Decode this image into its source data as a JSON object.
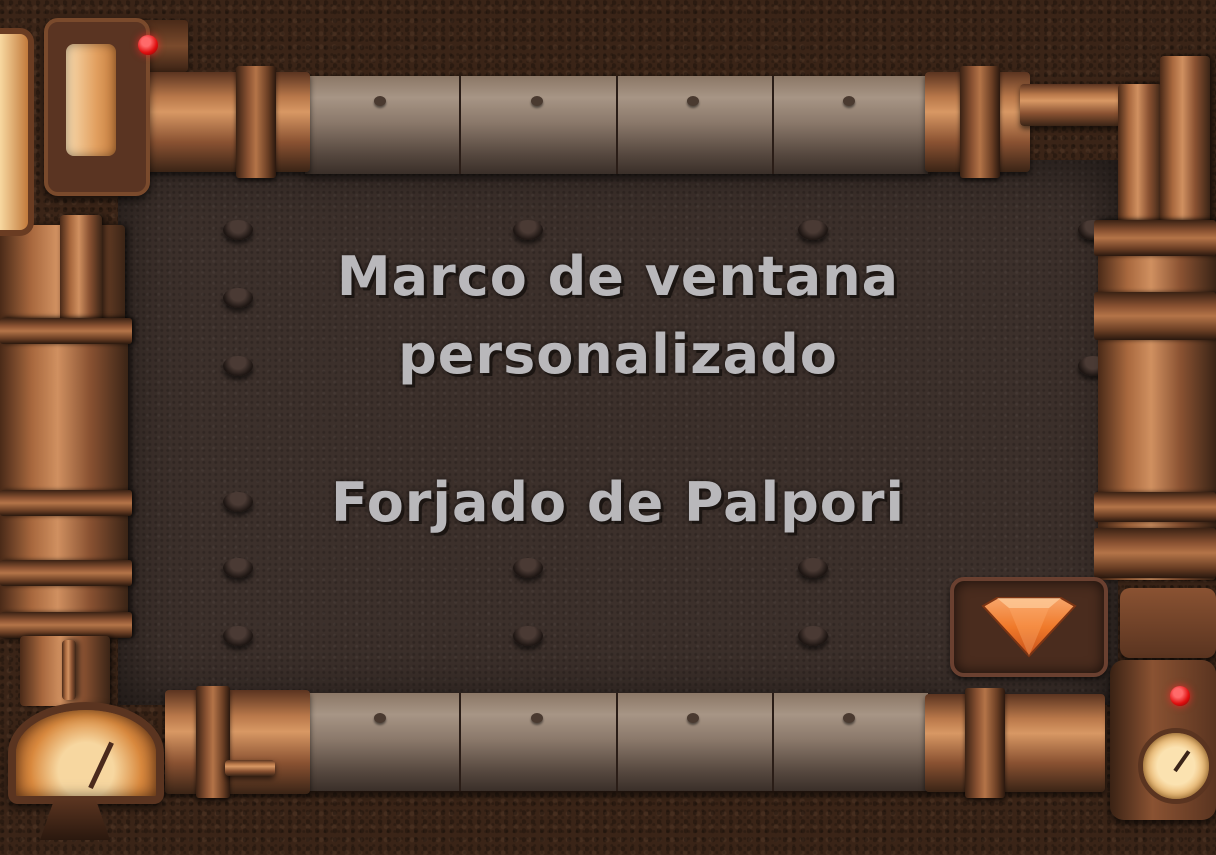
{
  "window": {
    "title_line1": "Marco de ventana",
    "title_line2": "personalizado",
    "subtitle": "Forjado de Palpori"
  },
  "controls": {
    "scroll_down_icon": "orange-gem-down-arrow-icon",
    "status_lamp_icon": "red-indicator-lamp-icon",
    "gauge_icon": "pressure-gauge-icon"
  },
  "colors": {
    "text": "#b9b8bb",
    "panel": "#3c302b",
    "copper": "#b9784a",
    "gem": "#f07a2a",
    "lamp": "#e01010"
  }
}
